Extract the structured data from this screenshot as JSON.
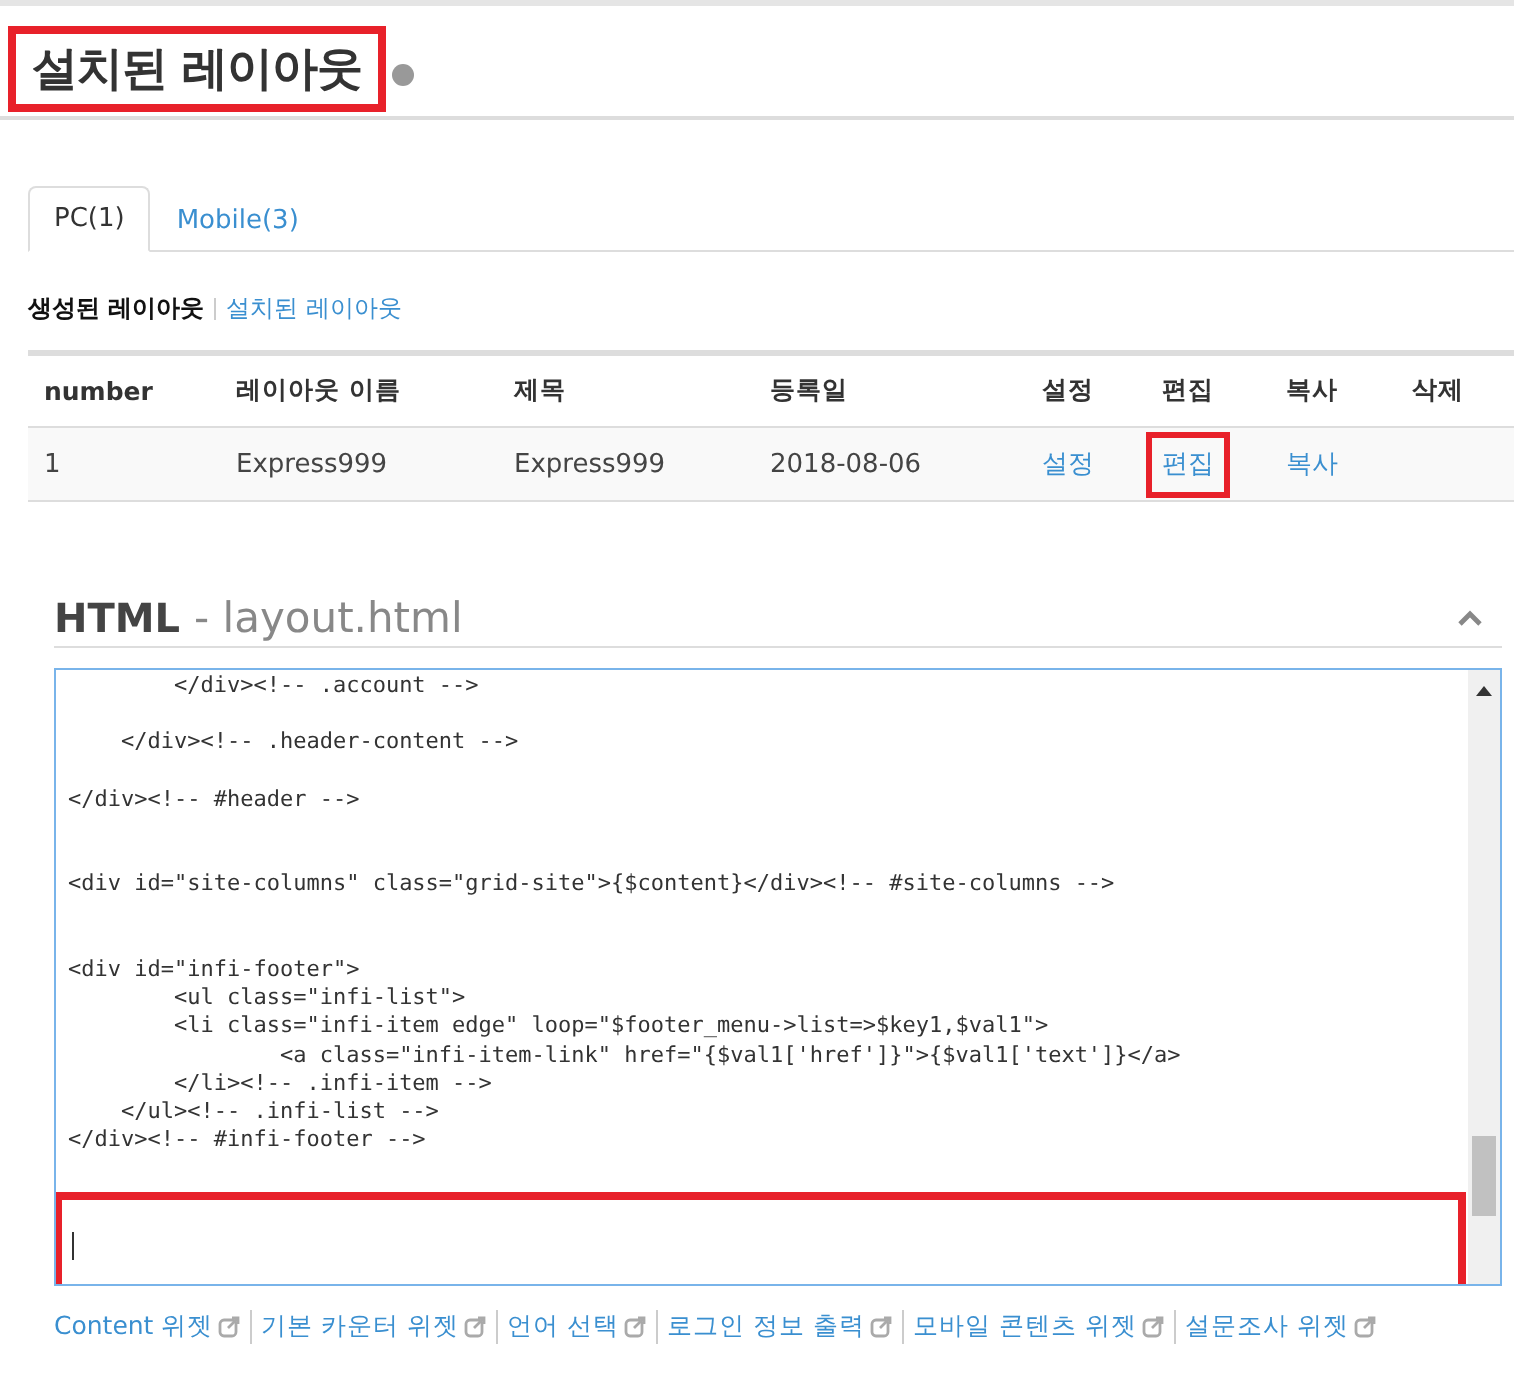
{
  "page_title": {
    "text": "설치된 레이아웃",
    "highlighted": true
  },
  "tabs": [
    {
      "label": "PC(1)",
      "selected": true
    },
    {
      "label": "Mobile(3)",
      "selected": false
    }
  ],
  "sub_links": [
    {
      "label": "생성된 레이아웃",
      "selected": true
    },
    {
      "label": "설치된 레이아웃",
      "selected": false
    }
  ],
  "table": {
    "columns": [
      "number",
      "레이아웃 이름",
      "제목",
      "등록일",
      "설정",
      "편집",
      "복사",
      "삭제"
    ],
    "rows": [
      {
        "cells": [
          {
            "text": "1",
            "kind": "text"
          },
          {
            "text": "Express999",
            "kind": "text"
          },
          {
            "text": "Express999",
            "kind": "text"
          },
          {
            "text": "2018-08-06",
            "kind": "text"
          },
          {
            "text": "설정",
            "kind": "link",
            "highlighted": false
          },
          {
            "text": "편집",
            "kind": "link",
            "highlighted": true
          },
          {
            "text": "복사",
            "kind": "link",
            "highlighted": false
          }
        ]
      }
    ]
  },
  "editor": {
    "title": "HTML",
    "filename": "- layout.html",
    "expanded": true,
    "code": "        </div><!-- .account -->\n\n    </div><!-- .header-content -->\n\n</div><!-- #header -->\n\n\n<div id=\"site-columns\" class=\"grid-site\">{$content}</div><!-- #site-columns -->\n\n\n<div id=\"infi-footer\">\n        <ul class=\"infi-list\">\n        <li class=\"infi-item edge\" loop=\"$footer_menu->list=>$key1,$val1\">\n                <a class=\"infi-item-link\" href=\"{$val1['href']}\">{$val1['text']}</a>\n        </li><!-- .infi-item -->\n    </ul><!-- .infi-list -->\n</div><!-- #infi-footer -->",
    "bottom_highlighted": true
  },
  "widget_links": [
    "Content 위젯",
    "기본 카운터 위젯",
    "언어 선택",
    "로그인 정보 출력",
    "모바일 콘텐츠 위젯",
    "설문조사 위젯"
  ]
}
